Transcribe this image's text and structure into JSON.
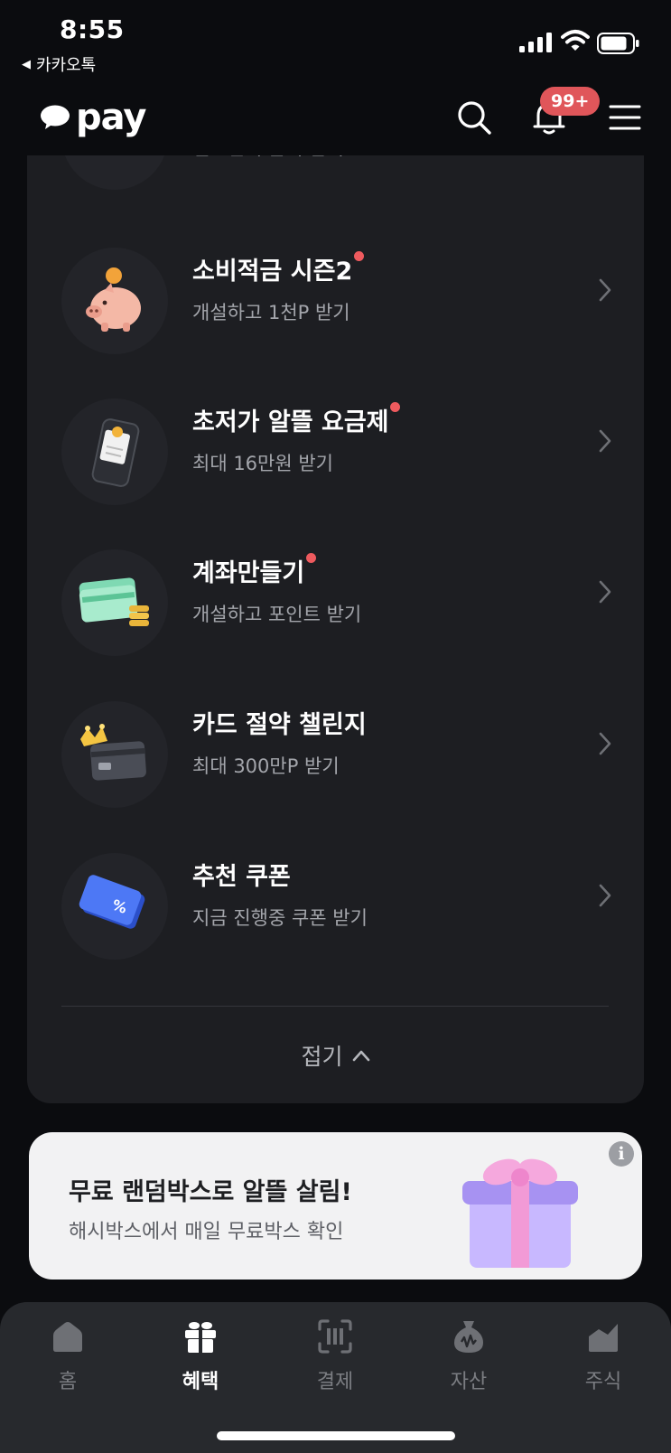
{
  "status_bar": {
    "time": "8:55",
    "back_app": "카카오톡"
  },
  "header": {
    "logo_text": "pay",
    "notification_badge": "99+"
  },
  "benefits": [
    {
      "title": "",
      "subtitle": "걸으면서 금리 받기",
      "new_dot": false,
      "icon": "walking-shoe-icon"
    },
    {
      "title": "소비적금 시즌2",
      "subtitle": "개설하고 1천P 받기",
      "new_dot": true,
      "icon": "piggy-bank-icon"
    },
    {
      "title": "초저가 알뜰 요금제",
      "subtitle": "최대 16만원 받기",
      "new_dot": true,
      "icon": "phone-bill-icon"
    },
    {
      "title": "계좌만들기",
      "subtitle": "개설하고 포인트 받기",
      "new_dot": true,
      "icon": "bank-card-coins-icon"
    },
    {
      "title": "카드 절약 챌린지",
      "subtitle": "최대 300만P 받기",
      "new_dot": false,
      "icon": "crown-card-icon"
    },
    {
      "title": "추천 쿠폰",
      "subtitle": "지금 진행중 쿠폰 받기",
      "new_dot": false,
      "icon": "coupon-icon"
    }
  ],
  "collapse_label": "접기",
  "banner": {
    "title": "무료 랜덤박스로 알뜰 살림!",
    "subtitle": "해시박스에서 매일 무료박스 확인",
    "info_icon": "i"
  },
  "tabs": [
    {
      "label": "홈",
      "icon": "home-icon",
      "active": false
    },
    {
      "label": "혜택",
      "icon": "gift-icon",
      "active": true
    },
    {
      "label": "결제",
      "icon": "scan-pay-icon",
      "active": false
    },
    {
      "label": "자산",
      "icon": "money-bag-icon",
      "active": false
    },
    {
      "label": "주식",
      "icon": "stock-chart-icon",
      "active": false
    }
  ],
  "colors": {
    "background": "#0b0c0f",
    "card": "#1d1e22",
    "accent_red": "#e0565a",
    "tabbar": "#27292d"
  }
}
